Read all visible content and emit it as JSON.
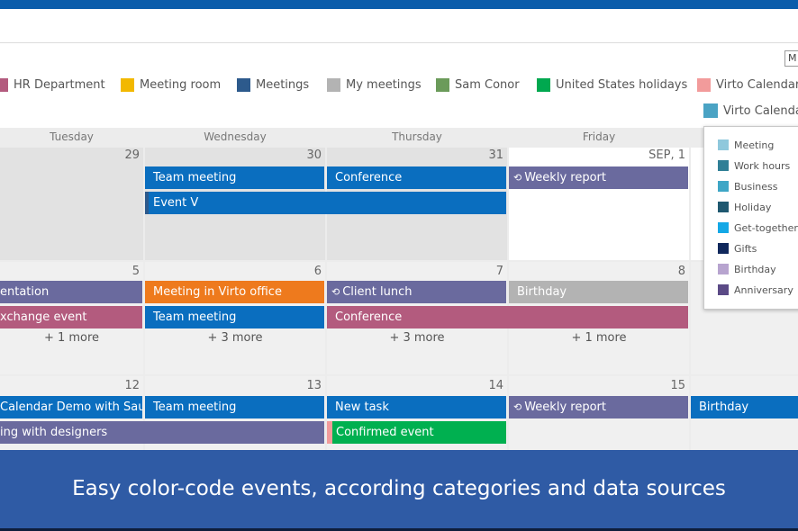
{
  "view_select_label": "M",
  "legend": [
    {
      "label": "HR Department",
      "color": "#b35b7e"
    },
    {
      "label": "Meeting room",
      "color": "#f2b800"
    },
    {
      "label": "Meetings",
      "color": "#2d5a8c"
    },
    {
      "label": "My meetings",
      "color": "#b3b3b3"
    },
    {
      "label": "Sam Conor",
      "color": "#6b9b5a"
    },
    {
      "label": "United States holidays",
      "color": "#00a84f"
    },
    {
      "label": "Virto Calendar D",
      "color": "#f29b9b"
    },
    {
      "label": "Virto Calendar",
      "color": "#4aa3c4"
    }
  ],
  "weekdays": [
    "Tuesday",
    "Wednesday",
    "Thursday",
    "Friday"
  ],
  "weeks": [
    {
      "days": [
        "29",
        "30",
        "31",
        "SEP, 1"
      ]
    },
    {
      "days": [
        "5",
        "6",
        "7",
        "8"
      ]
    },
    {
      "days": [
        "12",
        "13",
        "14",
        "15"
      ]
    }
  ],
  "events": {
    "team_meeting_1": "Team meeting",
    "conference_1": "Conference",
    "weekly_report_1": "Weekly report",
    "event_v": "Event V",
    "presentation": "entation",
    "meeting_virto": "Meeting in Virto office",
    "client_lunch": "Client lunch",
    "birthday_1": "Birthday",
    "exchange": "xchange event",
    "team_meeting_2": "Team meeting",
    "conference_2": "Conference",
    "calendar_demo": "Calendar Demo with Saul",
    "team_meeting_3": "Team meeting",
    "new_task": "New task",
    "weekly_report_2": "Weekly report",
    "birthday_2": "Birthday",
    "designers": "ing with designers",
    "confirmed": "Confirmed event"
  },
  "more": [
    "+ 1 more",
    "+ 3 more",
    "+ 3 more",
    "+ 1 more"
  ],
  "categories": [
    {
      "label": "Meeting",
      "color": "#8fc8dc"
    },
    {
      "label": "Work hours",
      "color": "#2f7f96"
    },
    {
      "label": "Business",
      "color": "#3ea6c6"
    },
    {
      "label": "Holiday",
      "color": "#1f5870"
    },
    {
      "label": "Get-together",
      "color": "#14a8e6"
    },
    {
      "label": "Gifts",
      "color": "#10285c"
    },
    {
      "label": "Birthday",
      "color": "#b7a4cf"
    },
    {
      "label": "Anniversary",
      "color": "#5b4a86"
    }
  ],
  "banner_text": "Easy color-code events, according categories and data sources",
  "colors": {
    "blue": "#0a6ebf",
    "purple": "#6a6a9e",
    "pink": "#b35b7e",
    "orange": "#ee7a1d",
    "gray": "#b3b3b3",
    "green": "#00b050",
    "banner": "#2f5ba5"
  }
}
